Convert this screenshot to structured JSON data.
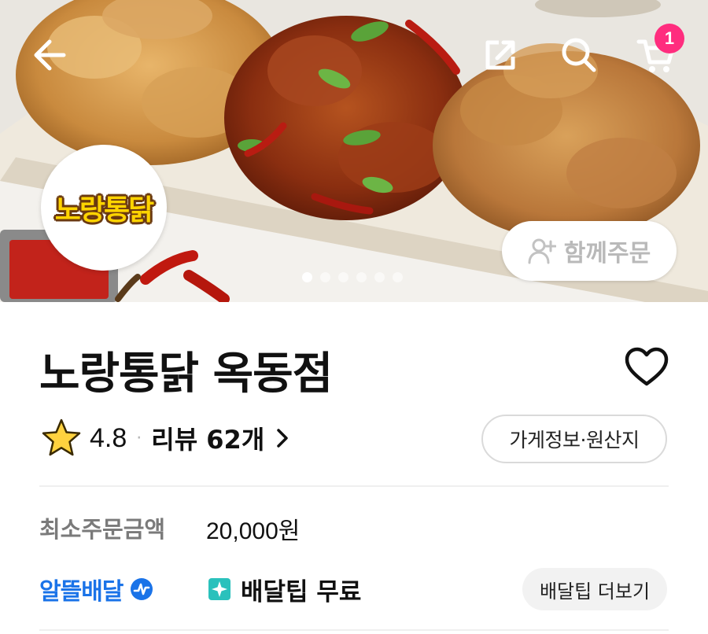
{
  "hero": {
    "logo_text": "노랑통닭",
    "group_order_label": "함께주문",
    "cart_count": "1",
    "slides_total": 6,
    "slide_active": 1,
    "icons": [
      "back-arrow-icon",
      "share-icon",
      "search-icon",
      "cart-icon",
      "person-add-icon"
    ]
  },
  "store": {
    "name": "노랑통닭 옥동점",
    "rating": "4.8",
    "separator": "·",
    "review_label": "리뷰 62개",
    "info_button": "가게정보·원산지"
  },
  "order": {
    "min_order_label": "최소주문금액",
    "min_order_value": "20,000원"
  },
  "delivery": {
    "alttle_label": "알뜰배달",
    "tip_free_label": "배달팁 무료",
    "tip_more_label": "배달팁 더보기"
  },
  "colors": {
    "cart_badge": "#ff2d7e",
    "alttle_blue": "#1a73e8",
    "star": "#ffd23f",
    "tip_icon": "#2ac1bc"
  }
}
